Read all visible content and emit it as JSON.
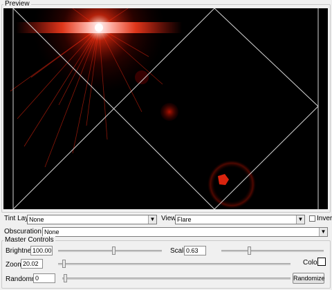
{
  "preview": {
    "title": "Preview"
  },
  "tint": {
    "label": "Tint Layer",
    "value": "None"
  },
  "view": {
    "label": "View",
    "value": "Flare"
  },
  "invert": {
    "label": "Invert",
    "checked": false
  },
  "obscuration": {
    "label": "Obscuration Layer",
    "value": "None"
  },
  "master": {
    "title": "Master Controls",
    "brightness": {
      "label": "Brightness:",
      "value": "100.00"
    },
    "scale": {
      "label": "Scale:",
      "value": "0.63"
    },
    "zoom": {
      "label": "Zoom:",
      "value": "20.02"
    },
    "color": {
      "label": "Color:",
      "swatch": "#ffffff"
    },
    "randomness": {
      "label": "Randomness:",
      "value": "0"
    },
    "randomize_label": "Randomize"
  },
  "colors": {
    "flare_core": "#ffffff",
    "flare_red": "#ff2a10",
    "overlay_lines": "#d8d8d8",
    "canvas": "#000000"
  }
}
